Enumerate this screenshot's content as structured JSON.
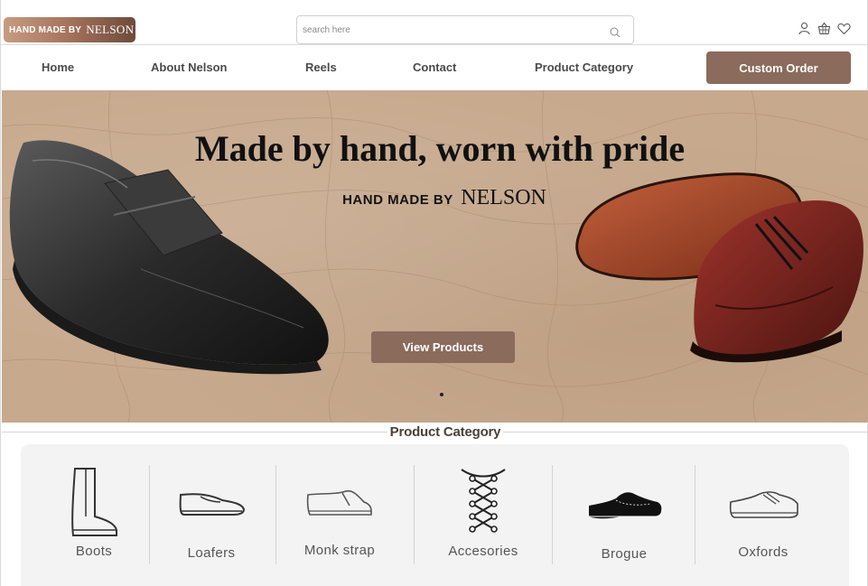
{
  "brand": {
    "part1": "HAND MADE BY",
    "part2": "NELSON"
  },
  "search": {
    "placeholder": "search here",
    "value": ""
  },
  "header_icons": [
    "user-icon",
    "basket-icon",
    "heart-icon"
  ],
  "nav": {
    "items": [
      "Home",
      "About Nelson",
      "Reels",
      "Contact",
      "Product Category"
    ],
    "custom_order": "Custom Order"
  },
  "hero": {
    "title": "Made by hand, worn with pride",
    "brand_part1": "HAND MADE BY",
    "brand_part2": "NELSON",
    "cta": "View Products"
  },
  "categories": {
    "title": "Product Category",
    "items": [
      {
        "label": "Boots",
        "icon": "boot-icon"
      },
      {
        "label": "Loafers",
        "icon": "loafer-icon"
      },
      {
        "label": "Monk strap",
        "icon": "monk-strap-icon"
      },
      {
        "label": "Accesories",
        "icon": "laces-icon"
      },
      {
        "label": "Brogue",
        "icon": "brogue-icon"
      },
      {
        "label": "Oxfords",
        "icon": "oxford-icon"
      }
    ]
  },
  "colors": {
    "accent": "#8b6b5c",
    "hero_bg": "#c7a98d",
    "panel_bg": "#f3f3f3"
  }
}
